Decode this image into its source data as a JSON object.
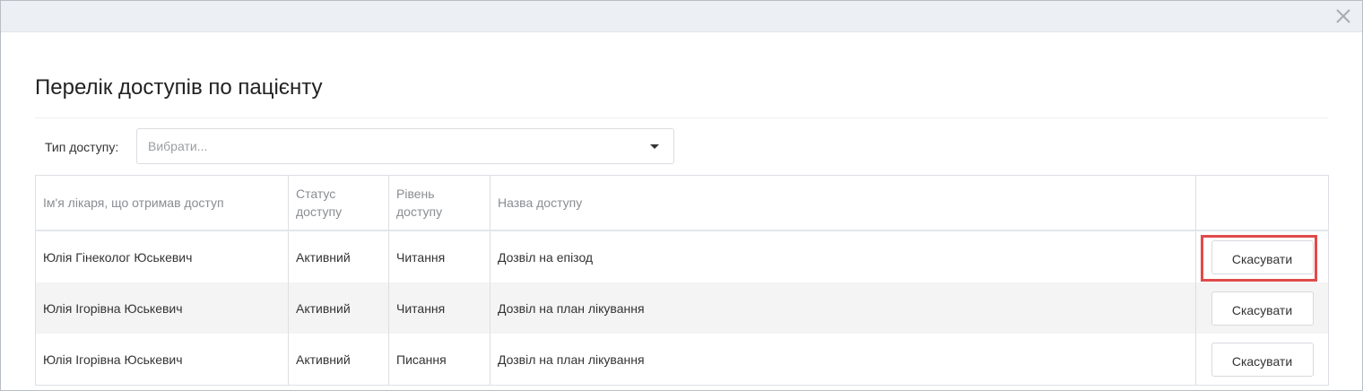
{
  "dialog": {
    "title": "Перелік доступів по пацієнту",
    "close_icon": "close-icon"
  },
  "filter": {
    "label": "Тип доступу:",
    "placeholder": "Вибрати...",
    "dropdown_icon": "caret-down-icon"
  },
  "table": {
    "columns": [
      "Ім'я лікаря, що отримав доступ",
      "Статус доступу",
      "Рівень доступу",
      "Назва доступу",
      ""
    ],
    "rows": [
      {
        "doctor": "Юлія Гінеколог Юськевич",
        "status": "Активний",
        "level": "Читання",
        "name": "Дозвіл на епізод",
        "action": "Скасувати",
        "highlighted": true
      },
      {
        "doctor": "Юлія Ігорівна Юськевич",
        "status": "Активний",
        "level": "Читання",
        "name": "Дозвіл на план лікування",
        "action": "Скасувати",
        "highlighted": false
      },
      {
        "doctor": "Юлія Ігорівна Юськевич",
        "status": "Активний",
        "level": "Писання",
        "name": "Дозвіл на план лікування",
        "action": "Скасувати",
        "highlighted": false
      }
    ]
  },
  "colors": {
    "header_bg": "#eceff4",
    "highlight_border": "#e04a4a",
    "alt_row_bg": "#f4f4f4"
  }
}
